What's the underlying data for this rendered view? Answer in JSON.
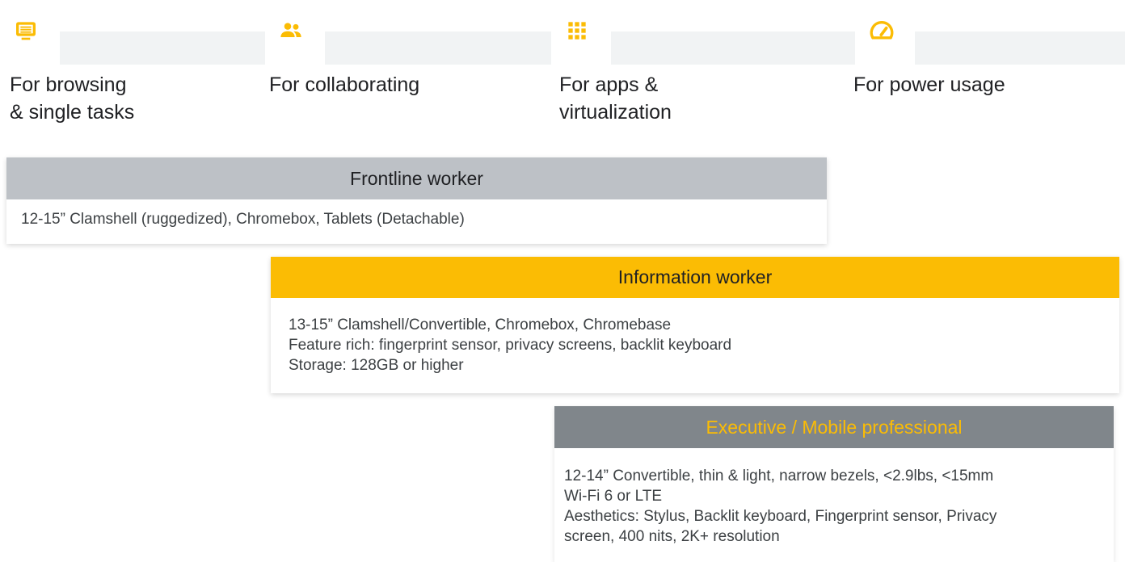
{
  "categories": [
    {
      "icon": "monitor-icon",
      "line1": "For browsing",
      "line2": "& single tasks"
    },
    {
      "icon": "people-icon",
      "line1": "For collaborating",
      "line2": ""
    },
    {
      "icon": "apps-grid-icon",
      "line1": "For apps &",
      "line2": "virtualization"
    },
    {
      "icon": "speedometer-icon",
      "line1": "For power usage",
      "line2": ""
    }
  ],
  "cards": [
    {
      "title": "Frontline worker",
      "lines": [
        "12-15” Clamshell (ruggedized), Chromebox, Tablets (Detachable)"
      ]
    },
    {
      "title": "Information worker",
      "lines": [
        "13-15” Clamshell/Convertible, Chromebox, Chromebase",
        "Feature rich: fingerprint sensor, privacy screens, backlit keyboard",
        "Storage: 128GB or higher"
      ]
    },
    {
      "title": "Executive / Mobile professional",
      "lines": [
        "12-14” Convertible, thin & light, narrow bezels, <2.9lbs, <15mm",
        "Wi-Fi 6 or LTE",
        "Aesthetics: Stylus, Backlit keyboard, Fingerprint sensor, Privacy",
        "screen, 400 nits, 2K+  resolution"
      ]
    }
  ],
  "colors": {
    "accent": "#fbbc04",
    "frontline_header": "#bdc1c6",
    "executive_header": "#80868b",
    "executive_title": "#fbbc04",
    "text": "#202124"
  }
}
